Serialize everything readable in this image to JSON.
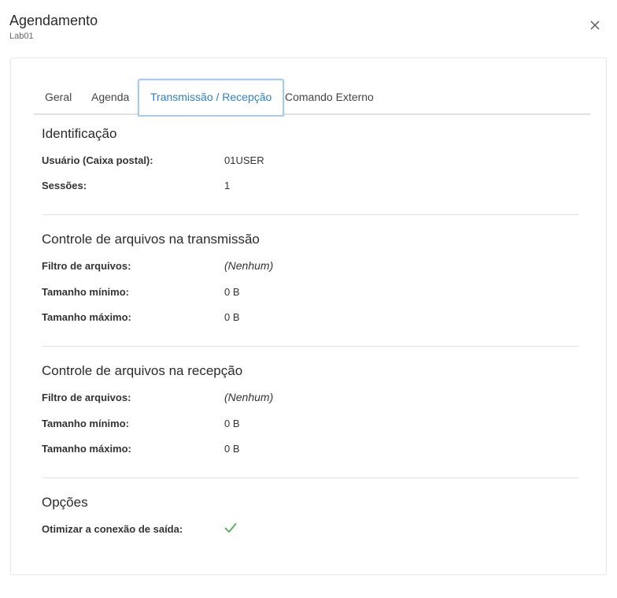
{
  "header": {
    "title": "Agendamento",
    "subtitle": "Lab01"
  },
  "tabs": [
    {
      "label": "Geral"
    },
    {
      "label": "Agenda"
    },
    {
      "label": "Transmissão / Recepção"
    },
    {
      "label": "Comando Externo"
    }
  ],
  "identificacao": {
    "title": "Identificação",
    "usuario_label": "Usuário (Caixa postal):",
    "usuario_value": "01USER",
    "sessoes_label": "Sessões:",
    "sessoes_value": "1"
  },
  "transmissao": {
    "title": "Controle de arquivos na transmissão",
    "filtro_label": "Filtro de arquivos:",
    "filtro_value": "(Nenhum)",
    "min_label": "Tamanho mínimo:",
    "min_value": "0 B",
    "max_label": "Tamanho máximo:",
    "max_value": "0 B"
  },
  "recepcao": {
    "title": "Controle de arquivos na recepção",
    "filtro_label": "Filtro de arquivos:",
    "filtro_value": "(Nenhum)",
    "min_label": "Tamanho mínimo:",
    "min_value": "0 B",
    "max_label": "Tamanho máximo:",
    "max_value": "0 B"
  },
  "opcoes": {
    "title": "Opções",
    "otimizar_label": "Otimizar a conexão de saída:",
    "otimizar_enabled": true
  },
  "icons": {
    "close": "close-icon",
    "check": "check-icon"
  },
  "colors": {
    "accent": "#2f80c4",
    "check": "#4caf50"
  }
}
